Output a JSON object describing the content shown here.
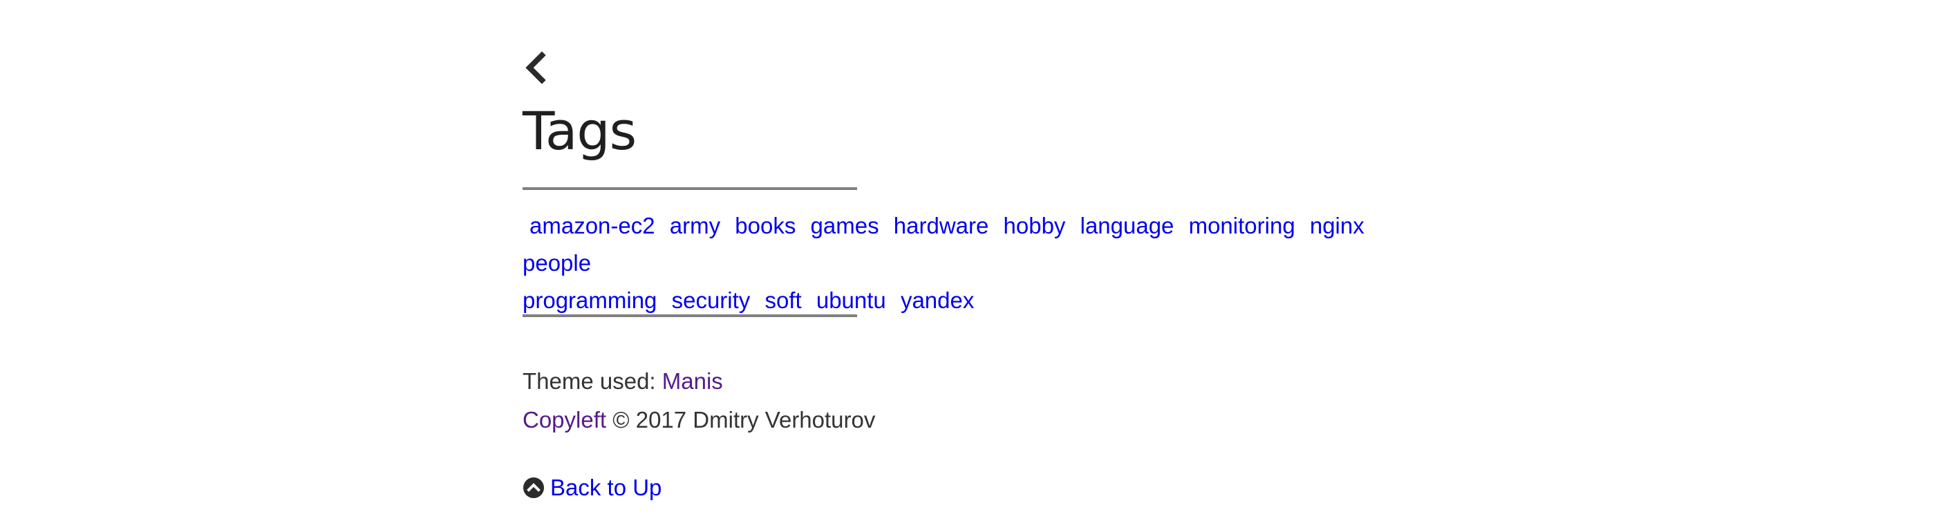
{
  "page": {
    "title": "Tags"
  },
  "nav": {
    "back_icon": "chevron-left-icon"
  },
  "tags": [
    "amazon-ec2",
    "army",
    "books",
    "games",
    "hardware",
    "hobby",
    "language",
    "monitoring",
    "nginx",
    "people",
    "programming",
    "security",
    "soft",
    "ubuntu",
    "yandex"
  ],
  "footer": {
    "theme_prefix": "Theme used:",
    "theme_link": "Manis",
    "copyleft_link": "Copyleft",
    "copyright_text": "© 2017 Dmitry Verhoturov"
  },
  "back_to_up": {
    "icon": "chevron-circle-up-icon",
    "label": "Back to Up"
  },
  "colors": {
    "link": "#0000ee",
    "visited_link": "#551a8b",
    "text": "#333333",
    "rule": "#808080"
  }
}
